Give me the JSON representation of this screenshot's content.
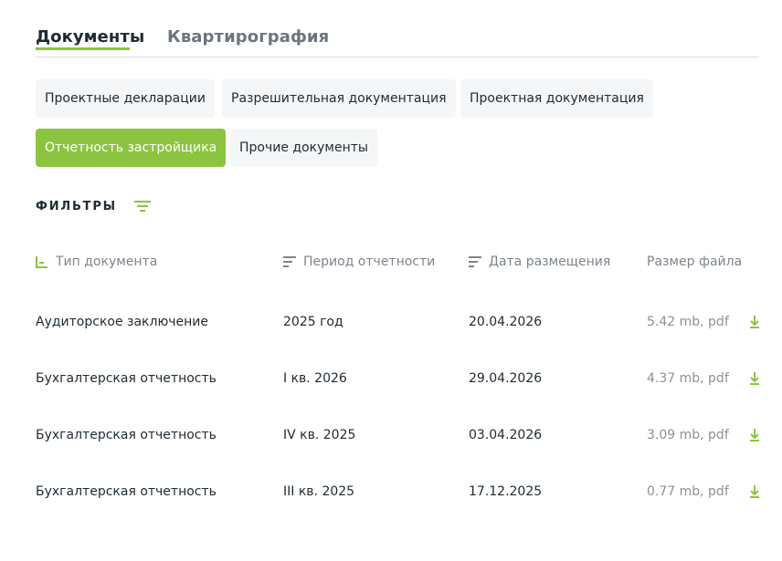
{
  "tabs": [
    {
      "label": "Документы",
      "active": true
    },
    {
      "label": "Квартирография",
      "active": false
    }
  ],
  "categories": [
    {
      "label": "Проектные декларации",
      "active": false
    },
    {
      "label": "Разрешительная документация",
      "active": false
    },
    {
      "label": "Проектная документация",
      "active": false
    },
    {
      "label": "Отчетность застройщика",
      "active": true
    },
    {
      "label": "Прочие документы",
      "active": false
    }
  ],
  "filters": {
    "label": "ФИЛЬТРЫ",
    "icon": "filter-lines-icon"
  },
  "columns": {
    "doc_type": "Тип документа",
    "period": "Период отчетности",
    "date": "Дата размещения",
    "size": "Размер файла"
  },
  "rows": [
    {
      "doc_type": "Аудиторское заключение",
      "period": "2025 год",
      "date": "20.04.2026",
      "size": "5.42 mb, pdf"
    },
    {
      "doc_type": "Бухгалтерская отчетность",
      "period": "I кв. 2026",
      "date": "29.04.2026",
      "size": "4.37 mb, pdf"
    },
    {
      "doc_type": "Бухгалтерская отчетность",
      "period": "IV кв. 2025",
      "date": "03.04.2026",
      "size": "3.09 mb, pdf"
    },
    {
      "doc_type": "Бухгалтерская отчетность",
      "period": "III кв. 2025",
      "date": "17.12.2025",
      "size": "0.77 mb, pdf"
    }
  ],
  "colors": {
    "accent": "#8bc540",
    "text": "#1f2a33",
    "muted": "#7d858d",
    "chip_bg": "#f5f6f7"
  }
}
